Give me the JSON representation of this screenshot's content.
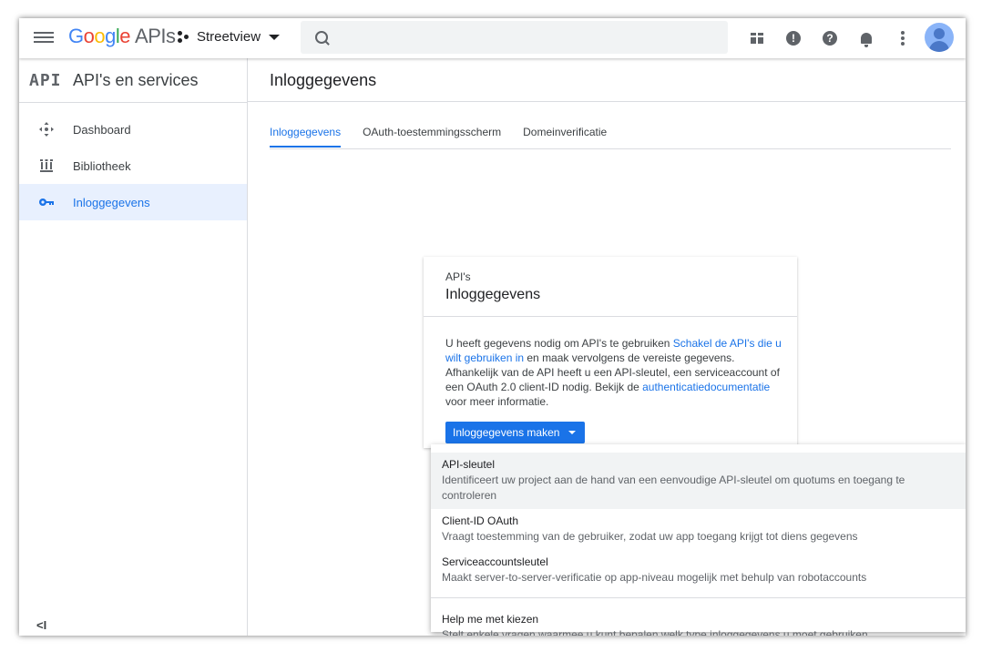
{
  "topbar": {
    "logo_google": [
      "G",
      "o",
      "o",
      "g",
      "l",
      "e"
    ],
    "logo_suffix": "APIs",
    "project": "Streetview",
    "search_placeholder": ""
  },
  "sidebar": {
    "badge": "API",
    "title": "API's en services",
    "items": [
      {
        "label": "Dashboard",
        "icon": "dashboard-icon"
      },
      {
        "label": "Bibliotheek",
        "icon": "library-icon"
      },
      {
        "label": "Inloggegevens",
        "icon": "key-icon"
      }
    ],
    "collapse_label": "<I"
  },
  "main": {
    "page_title": "Inloggegevens",
    "tabs": [
      "Inloggegevens",
      "OAuth-toestemmingsscherm",
      "Domeinverificatie"
    ]
  },
  "card": {
    "eyebrow": "API's",
    "title": "Inloggegevens",
    "desc_1": "U heeft gegevens nodig om API's te gebruiken ",
    "desc_link_1": "Schakel de API's die u wilt gebruiken in",
    "desc_2": " en maak vervolgens de vereiste gegevens. Afhankelijk van de API heeft u een API-sleutel, een serviceaccount of een OAuth 2.0 client-ID nodig. Bekijk de ",
    "desc_link_2": "authenticatiedocumentatie",
    "desc_3": " voor meer informatie.",
    "button": "Inloggegevens maken"
  },
  "menu": {
    "items": [
      {
        "title": "API-sleutel",
        "desc": "Identificeert uw project aan de hand van een eenvoudige API-sleutel om quotums en toegang te controleren"
      },
      {
        "title": "Client-ID OAuth",
        "desc": "Vraagt toestemming van de gebruiker, zodat uw app toegang krijgt tot diens gegevens"
      },
      {
        "title": "Serviceaccountsleutel",
        "desc": "Maakt server-to-server-verificatie op app-niveau mogelijk met behulp van robotaccounts"
      },
      {
        "title": "Help me met kiezen",
        "desc": "Stelt enkele vragen waarmee u kunt bepalen welk type inloggegevens u moet gebruiken"
      }
    ]
  },
  "colors": {
    "accent": "#1a73e8",
    "active_bg": "#e8f0fe"
  }
}
